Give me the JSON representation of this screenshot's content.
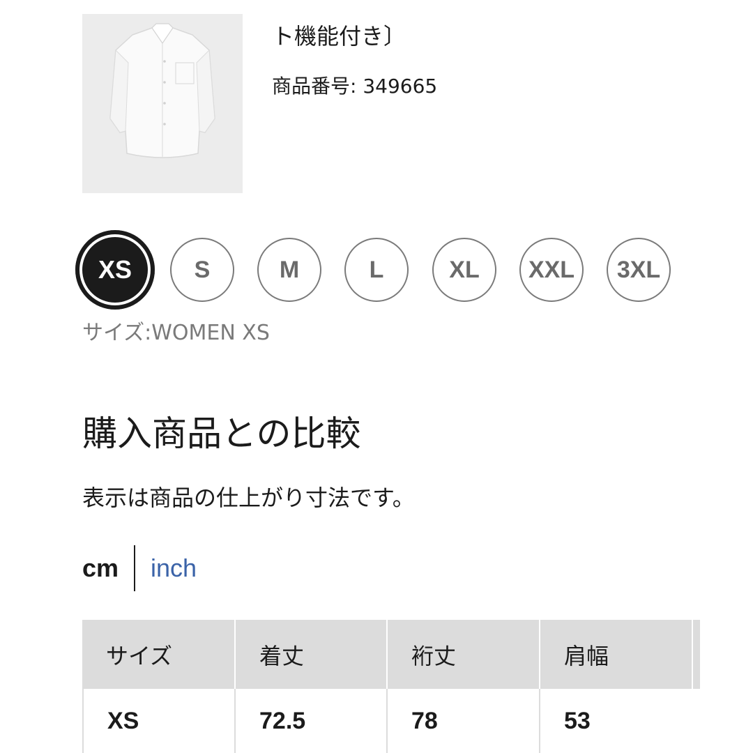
{
  "product": {
    "name_fragment": "ト機能付き〕",
    "number_label": "商品番号:",
    "number_value": "349665"
  },
  "sizes": {
    "options": [
      "XS",
      "S",
      "M",
      "L",
      "XL",
      "XXL",
      "3XL"
    ],
    "selected": "XS",
    "caption_label": "サイズ:",
    "caption_value": "WOMEN XS"
  },
  "comparison": {
    "title": "購入商品との比較",
    "note": "表示は商品の仕上がり寸法です。",
    "units": {
      "active": "cm",
      "alternate": "inch"
    },
    "table": {
      "headers": [
        "サイズ",
        "着丈",
        "裄丈",
        "肩幅"
      ],
      "rows": [
        [
          "XS",
          "72.5",
          "78",
          "53"
        ]
      ]
    }
  },
  "colors": {
    "selected_chip": "#1b1b1b",
    "chip_border": "#7a7a7a",
    "link": "#3b63a8",
    "table_header": "#dcdcdc",
    "thumbnail_bg": "#ececec"
  }
}
